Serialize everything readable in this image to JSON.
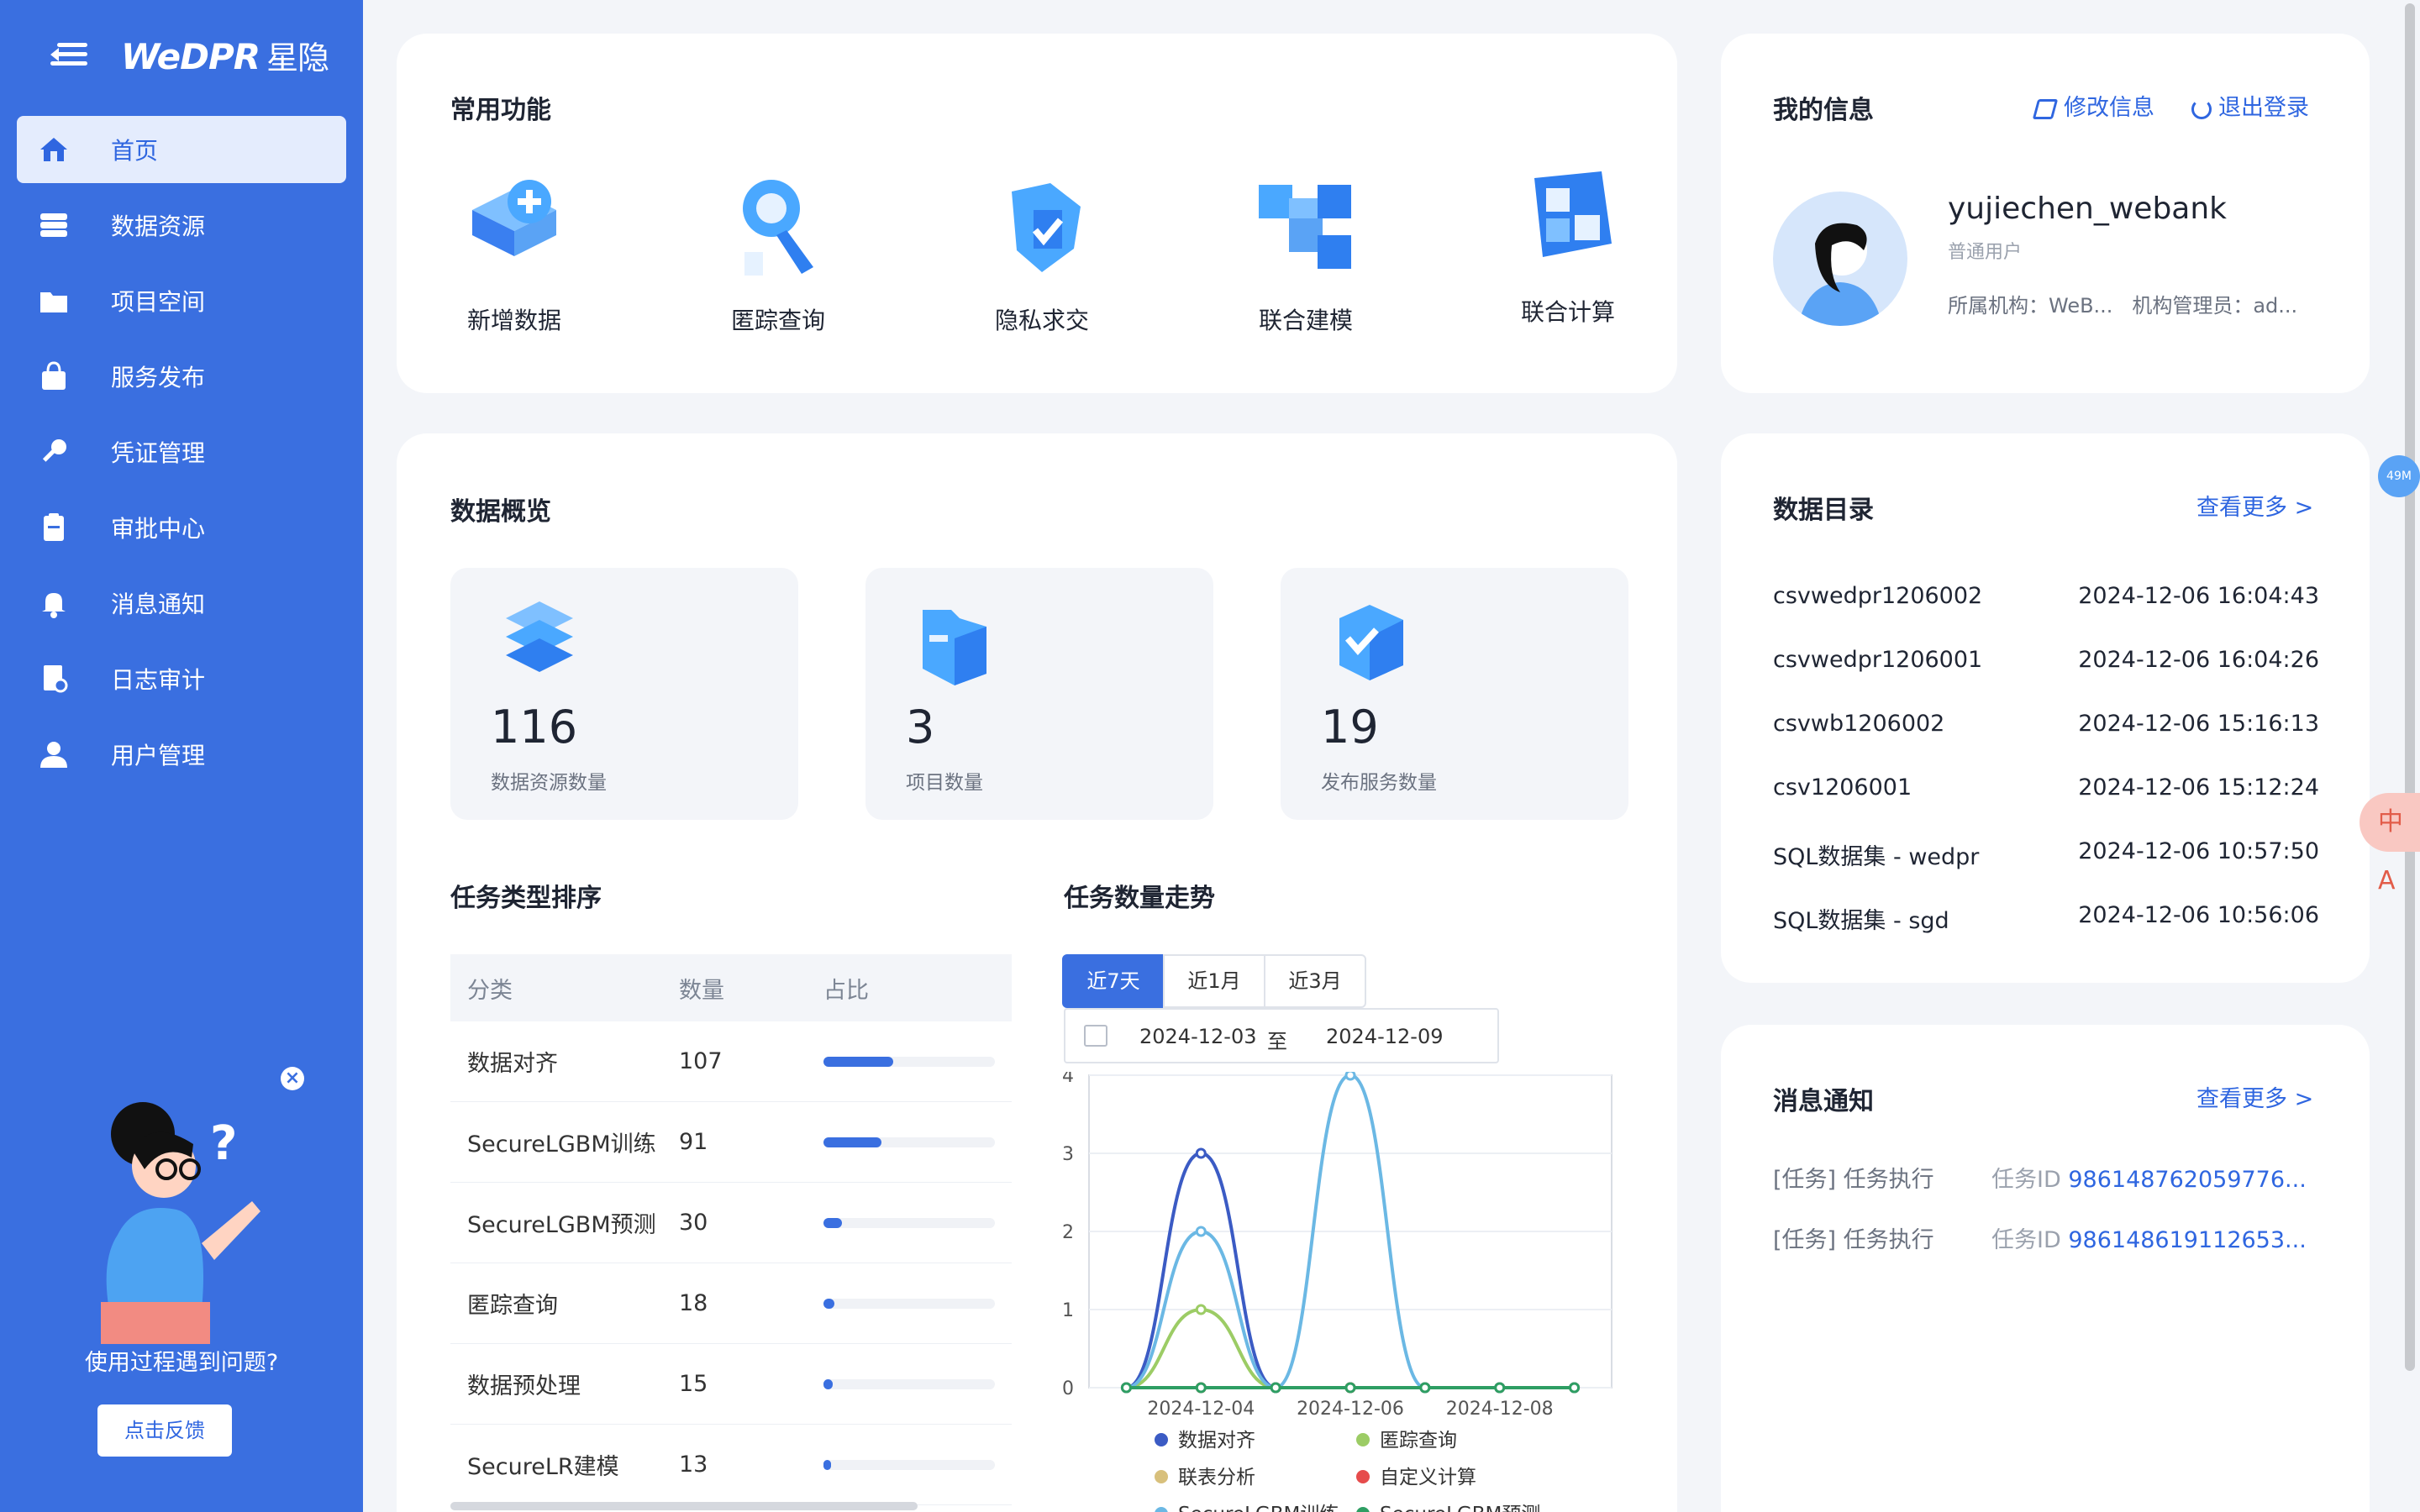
{
  "brand": {
    "logo": "WeDPR",
    "logo_cn": "星隐"
  },
  "sidebar": {
    "items": [
      {
        "label": "首页",
        "icon": "home-icon",
        "active": true
      },
      {
        "label": "数据资源",
        "icon": "database-icon"
      },
      {
        "label": "项目空间",
        "icon": "folder-icon"
      },
      {
        "label": "服务发布",
        "icon": "bag-icon"
      },
      {
        "label": "凭证管理",
        "icon": "key-icon"
      },
      {
        "label": "审批中心",
        "icon": "clipboard-icon"
      },
      {
        "label": "消息通知",
        "icon": "bell-icon"
      },
      {
        "label": "日志审计",
        "icon": "log-icon"
      },
      {
        "label": "用户管理",
        "icon": "user-icon"
      }
    ],
    "help": {
      "question": "使用过程遇到问题?",
      "button": "点击反馈"
    }
  },
  "common": {
    "title": "常用功能",
    "items": [
      {
        "label": "新增数据",
        "icon": "add-data-icon"
      },
      {
        "label": "匿踪查询",
        "icon": "search-anon-icon"
      },
      {
        "label": "隐私求交",
        "icon": "privacy-shield-icon"
      },
      {
        "label": "联合建模",
        "icon": "cubes-icon"
      },
      {
        "label": "联合计算",
        "icon": "calc-icon"
      }
    ]
  },
  "info": {
    "title": "我的信息",
    "edit": "修改信息",
    "logout": "退出登录",
    "username": "yujiechen_webank",
    "role": "普通用户",
    "org_label": "所属机构：WeB...",
    "admin_label": "机构管理员：ad..."
  },
  "overview": {
    "title": "数据概览",
    "stats": [
      {
        "value": "116",
        "label": "数据资源数量"
      },
      {
        "value": "3",
        "label": "项目数量"
      },
      {
        "value": "19",
        "label": "发布服务数量"
      }
    ]
  },
  "ranking": {
    "title": "任务类型排序",
    "headers": [
      "分类",
      "数量",
      "占比"
    ],
    "rows": [
      {
        "name": "数据对齐",
        "count": "107",
        "ratio": 0.37
      },
      {
        "name": "SecureLGBM训练",
        "count": "91",
        "ratio": 0.31
      },
      {
        "name": "SecureLGBM预测",
        "count": "30",
        "ratio": 0.1
      },
      {
        "name": "匿踪查询",
        "count": "18",
        "ratio": 0.06
      },
      {
        "name": "数据预处理",
        "count": "15",
        "ratio": 0.05
      },
      {
        "name": "SecureLR建模",
        "count": "13",
        "ratio": 0.04
      }
    ]
  },
  "trend": {
    "title": "任务数量走势",
    "tabs": [
      "近7天",
      "近1月",
      "近3月"
    ],
    "start_date": "2024-12-03",
    "to": "至",
    "end_date": "2024-12-09"
  },
  "chart_data": {
    "type": "line",
    "x": [
      "2024-12-03",
      "2024-12-04",
      "2024-12-05",
      "2024-12-06",
      "2024-12-07",
      "2024-12-08",
      "2024-12-09"
    ],
    "xticks": [
      "2024-12-04",
      "2024-12-06",
      "2024-12-08"
    ],
    "ylim": [
      0,
      4
    ],
    "yticks": [
      "0",
      "1",
      "2",
      "3",
      "4"
    ],
    "series": [
      {
        "name": "数据对齐",
        "color": "#3b5bc4",
        "values": [
          0,
          3,
          0,
          0,
          0,
          0,
          0
        ]
      },
      {
        "name": "匿踪查询",
        "color": "#9ccc65",
        "values": [
          0,
          1,
          0,
          0,
          0,
          0,
          0
        ]
      },
      {
        "name": "联表分析",
        "color": "#d8c07c",
        "values": [
          0,
          0,
          0,
          0,
          0,
          0,
          0
        ]
      },
      {
        "name": "自定义计算",
        "color": "#e64c4c",
        "values": [
          0,
          0,
          0,
          0,
          0,
          0,
          0
        ]
      },
      {
        "name": "SecureLGBM训练",
        "color": "#6bb8e4",
        "values": [
          0,
          2,
          0,
          4,
          0,
          0,
          0
        ]
      },
      {
        "name": "SecureLGBM预测",
        "color": "#2e9e63",
        "values": [
          0,
          0,
          0,
          0,
          0,
          0,
          0
        ]
      }
    ],
    "legend": "bottom"
  },
  "catalog": {
    "title": "数据目录",
    "more": "查看更多 >",
    "rows": [
      {
        "name": "csvwedpr1206002",
        "time": "2024-12-06 16:04:43"
      },
      {
        "name": "csvwedpr1206001",
        "time": "2024-12-06 16:04:26"
      },
      {
        "name": "csvwb1206002",
        "time": "2024-12-06 15:16:13"
      },
      {
        "name": "csv1206001",
        "time": "2024-12-06 15:12:24"
      },
      {
        "name": "SQL数据集 - wedpr",
        "time": "2024-12-06 10:57:50"
      },
      {
        "name": "SQL数据集 - sgd",
        "time": "2024-12-06 10:56:06"
      }
    ]
  },
  "messages": {
    "title": "消息通知",
    "more": "查看更多 >",
    "rows": [
      {
        "type": "[任务] 任务执行",
        "id_label": "任务ID",
        "id": "986148762059776..."
      },
      {
        "type": "[任务] 任务执行",
        "id_label": "任务ID",
        "id": "986148619112653..."
      }
    ]
  },
  "widgets": {
    "memory": "49M",
    "translate": "中A"
  },
  "colors": {
    "primary": "#3a6fe0",
    "sidebar_bg": "#3a6fe0",
    "page_bg": "#f3f5f9"
  }
}
